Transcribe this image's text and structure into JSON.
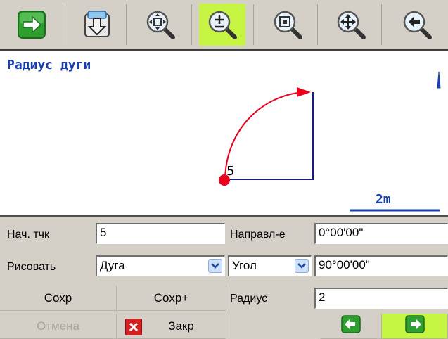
{
  "toolbar": {
    "buttons": [
      {
        "icon": "green-arrow-right-icon",
        "active": false
      },
      {
        "icon": "save-to-device-icon",
        "active": false
      },
      {
        "icon": "zoom-extents-icon",
        "active": false
      },
      {
        "icon": "zoom-in-out-icon",
        "active": true
      },
      {
        "icon": "zoom-window-icon",
        "active": false
      },
      {
        "icon": "pan-icon",
        "active": false
      },
      {
        "icon": "zoom-previous-icon",
        "active": false
      }
    ],
    "active_color": "#c5f542"
  },
  "canvas": {
    "title": "Радиус дуги",
    "point_label": "5",
    "scale_label": "2m",
    "colors": {
      "text": "#1a3fb0",
      "arc": "#e8001c",
      "line": "#1a1a80"
    }
  },
  "form": {
    "start_point": {
      "label": "Нач. тчк",
      "value": "5"
    },
    "direction": {
      "label": "Направл-е",
      "value": "0°00'00\""
    },
    "draw": {
      "label": "Рисовать",
      "selected": "Дуга"
    },
    "angle_type": {
      "selected": "Угол"
    },
    "angle_value": "90°00'00\"",
    "radius": {
      "label": "Радиус",
      "value": "2"
    },
    "buttons": {
      "save": "Сохр",
      "save_plus": "Сохр+",
      "cancel": "Отмена",
      "close": "Закр"
    }
  }
}
